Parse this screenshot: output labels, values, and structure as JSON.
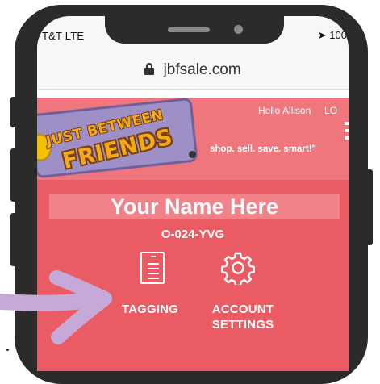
{
  "status_bar": {
    "carrier": "T&T  LTE",
    "battery": "100"
  },
  "browser": {
    "url": "jbfsale.com"
  },
  "site_header": {
    "logo_line1": "JUST BETWEEN",
    "logo_line2": "FRIENDS",
    "greeting": "Hello Allison",
    "login_truncated": "LO",
    "tagline": "shop. sell. save. smart!\""
  },
  "dashboard": {
    "user_name": "Your Name Here",
    "member_code": "O-024-YVG",
    "nav": [
      {
        "label": "TAGGING",
        "icon": "clipboard-icon"
      },
      {
        "label_line1": "ACCOUNT",
        "label_line2": "SETTINGS",
        "icon": "gear-icon"
      }
    ]
  },
  "colors": {
    "screen_background": "#ea5b63",
    "header_background": "#ef767c",
    "highlight_arrow": "#c6a9d8",
    "phone_frame": "#2b2b2b"
  }
}
